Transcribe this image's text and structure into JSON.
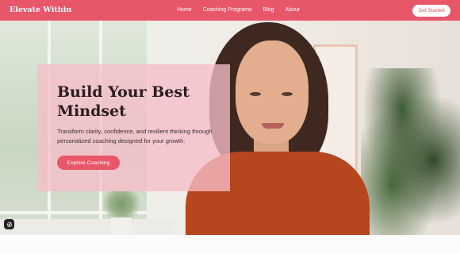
{
  "header": {
    "brand": "Elevate Within",
    "nav": [
      "Home",
      "Coaching Programs",
      "Blog",
      "About"
    ],
    "cta_label": "Get Started"
  },
  "hero": {
    "headline": "Build Your Best Mindset",
    "subtext": "Transform clarity, confidence, and resilient thinking through personalized coaching designed for your growth.",
    "cta_label": "Explore Coaching"
  },
  "widget": {
    "icon": "settings-gear-icon"
  },
  "colors": {
    "brand": "#e8566a",
    "card_overlay": "#f6bec8",
    "headline": "#2a1d1f",
    "sweater": "#b6461e"
  }
}
